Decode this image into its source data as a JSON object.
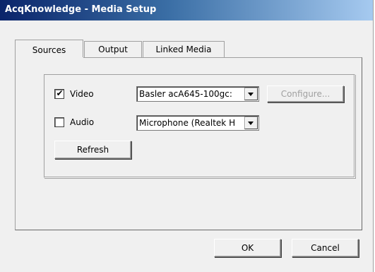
{
  "window": {
    "title": "AcqKnowledge - Media Setup"
  },
  "tabs": [
    {
      "label": "Sources",
      "active": true
    },
    {
      "label": "Output",
      "active": false
    },
    {
      "label": "Linked Media",
      "active": false
    }
  ],
  "sources": {
    "video": {
      "label": "Video",
      "checked": true,
      "device": "Basler acA645-100gc:"
    },
    "audio": {
      "label": "Audio",
      "checked": false,
      "device": "Microphone (Realtek H"
    },
    "configure_label": "Configure...",
    "refresh_label": "Refresh"
  },
  "footer": {
    "ok_label": "OK",
    "cancel_label": "Cancel"
  },
  "icons": {
    "checkmark": "✔"
  }
}
